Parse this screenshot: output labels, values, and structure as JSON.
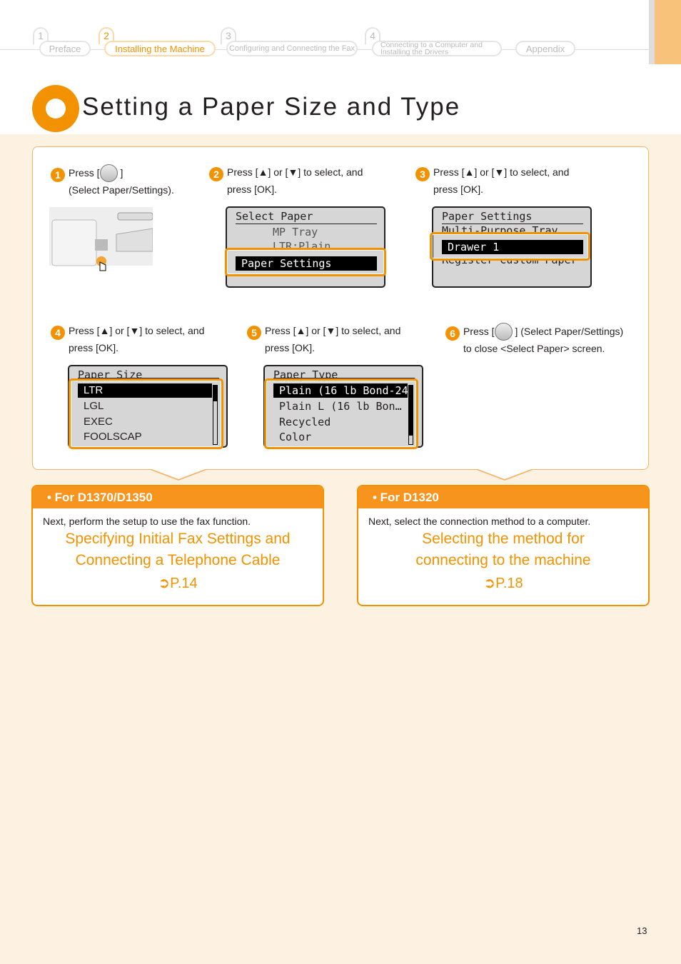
{
  "nav": [
    {
      "num": "1",
      "label": "Preface"
    },
    {
      "num": "2",
      "label": "Installing the Machine"
    },
    {
      "num": "3",
      "label": "Configuring and Connecting the Fax"
    },
    {
      "num": "4",
      "label": "Connecting to a Computer and Installing the Drivers"
    },
    {
      "num": "",
      "label": "Appendix"
    }
  ],
  "title": "Setting a Paper Size and Type",
  "colors": {
    "accent": "#f39200",
    "background": "#fdf2e2"
  },
  "steps": [
    {
      "n": "1",
      "a": "Press [",
      "b": "]",
      "c": "(Select Paper/Settings)."
    },
    {
      "n": "2",
      "a": "Press [",
      "or": "] or [",
      "b": "] to select, and",
      "c": "press [OK]."
    },
    {
      "n": "3",
      "a": "Press [",
      "or": "] or [",
      "b": "] to select, and",
      "c": "press [OK]."
    },
    {
      "n": "4",
      "a": "Press [",
      "or": "] or [",
      "b": "] to select, and",
      "c": "press [OK]."
    },
    {
      "n": "5",
      "a": "Press [",
      "or": "] or [",
      "b": "] to select, and",
      "c": "press [OK]."
    },
    {
      "n": "6",
      "a": "Press [",
      "b": "] (Select Paper/Settings)",
      "c": "to close <Select Paper> screen."
    }
  ],
  "lcd2": {
    "header": "Select Paper",
    "rows": [
      "MP Tray",
      "LTR:Plain"
    ],
    "selected": "Paper Settings"
  },
  "lcd3": {
    "header": "Paper Settings",
    "rows": [
      "Multi-Purpose Tray",
      "Register Custom Paper"
    ],
    "selected": "Drawer 1"
  },
  "lcd4": {
    "header": "Paper Size",
    "selected": "LTR",
    "rows": [
      "LGL",
      "EXEC",
      "FOOLSCAP"
    ]
  },
  "lcd5": {
    "header": "Paper Type",
    "selected": "Plain (16 lb Bond-24",
    "rows": [
      "Plain L (16 lb Bond…",
      "Recycled",
      "Color"
    ]
  },
  "boxes": [
    {
      "heading": "• For D1370/D1350",
      "intro": "Next, perform the setup to use the fax function.",
      "link1": "Specifying Initial Fax Settings and",
      "link2": "Connecting a Telephone Cable",
      "page": "P.14"
    },
    {
      "heading": "• For D1320",
      "intro": "Next, select the connection method to a computer.",
      "link1": "Selecting the method for",
      "link2": "connecting to the machine",
      "page": "P.18"
    }
  ],
  "page_number": "13"
}
